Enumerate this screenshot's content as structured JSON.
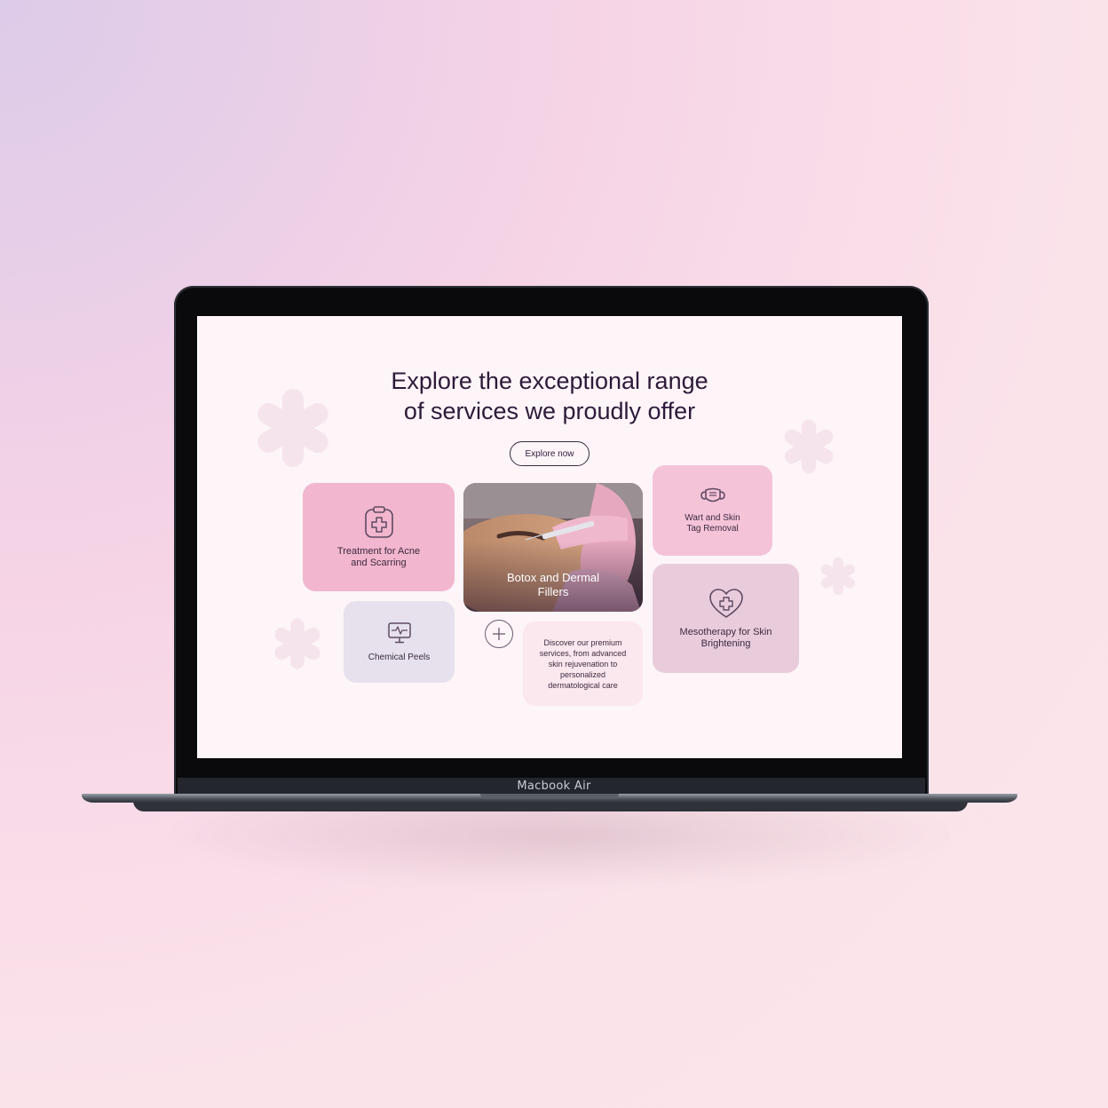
{
  "device": {
    "label": "Macbook Air"
  },
  "page": {
    "headline_line1": "Explore the exceptional range",
    "headline_line2": "of services we proudly offer",
    "cta_label": "Explore now"
  },
  "services": {
    "acne": {
      "label": "Treatment for Acne\nand Scarring",
      "icon": "clipboard-cross-icon"
    },
    "botox": {
      "label": "Botox and Dermal\nFillers",
      "image": "injection-photo"
    },
    "wart": {
      "label": "Wart and Skin\nTag Removal",
      "icon": "face-mask-icon"
    },
    "meso": {
      "label": "Mesotherapy for Skin\nBrightening",
      "icon": "heart-cross-icon"
    },
    "peel": {
      "label": "Chemical Peels",
      "icon": "monitor-pulse-icon"
    },
    "description": "Discover our premium\nservices, from advanced\nskin rejuvenation to\npersonalized\ndermatological care"
  },
  "plus_button": {
    "icon": "plus-icon"
  },
  "colors": {
    "accent_pink": "#f2b6ce",
    "soft_pink": "#f5c3d8",
    "mauve": "#e9ccdc",
    "lavender": "#e6e1ec",
    "text_dark": "#2d1a3a"
  }
}
